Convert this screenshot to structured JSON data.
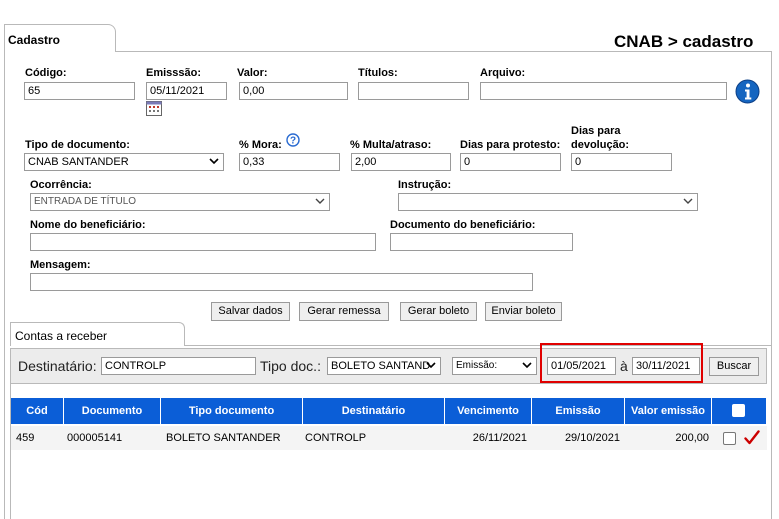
{
  "header": {
    "tab_label": "Cadastro",
    "breadcrumb": "CNAB > cadastro"
  },
  "form": {
    "codigo": {
      "label": "Código:",
      "value": "65"
    },
    "emissao": {
      "label": "Emisssão:",
      "value": "05/11/2021"
    },
    "valor": {
      "label": "Valor:",
      "value": "0,00"
    },
    "titulos": {
      "label": "Títulos:",
      "value": ""
    },
    "arquivo": {
      "label": "Arquivo:",
      "value": ""
    },
    "tipo_documento": {
      "label": "Tipo de documento:",
      "value": "CNAB SANTANDER"
    },
    "mora": {
      "label": "% Mora:",
      "value": "0,33"
    },
    "multa": {
      "label": "% Multa/atraso:",
      "value": "2,00"
    },
    "dias_protesto": {
      "label": "Dias para protesto:",
      "value": "0"
    },
    "dias_devolucao": {
      "label_line1": "Dias para",
      "label_line2": "devolução:",
      "value": "0"
    },
    "ocorrencia": {
      "label": "Ocorrência:",
      "value": "ENTRADA DE TÍTULO"
    },
    "instrucao": {
      "label": "Instrução:",
      "value": ""
    },
    "nome_beneficiario": {
      "label": "Nome do beneficiário:",
      "value": ""
    },
    "documento_beneficiario": {
      "label": "Documento do beneficiário:",
      "value": ""
    },
    "mensagem": {
      "label": "Mensagem:",
      "value": ""
    }
  },
  "actions": {
    "salvar": "Salvar dados",
    "gerar_remessa": "Gerar remessa",
    "gerar_boleto": "Gerar boleto",
    "enviar_boleto": "Enviar boleto"
  },
  "receivables": {
    "tab_label": "Contas a receber",
    "filter": {
      "destinatario_label": "Destinatário:",
      "destinatario_value": "CONTROLP",
      "tipo_doc_label": "Tipo doc.:",
      "tipo_doc_value": "BOLETO SANTAND",
      "date_type_value": "Emissão:",
      "date_from": "01/05/2021",
      "date_sep": "à",
      "date_to": "30/11/2021",
      "search_label": "Buscar"
    },
    "columns": [
      "Cód",
      "Documento",
      "Tipo documento",
      "Destinatário",
      "Vencimento",
      "Emissão",
      "Valor emissão"
    ],
    "rows": [
      {
        "cod": "459",
        "documento": "000005141",
        "tipo": "BOLETO SANTANDER",
        "destinatario": "CONTROLP",
        "vencimento": "26/11/2021",
        "emissao": "29/10/2021",
        "valor": "200,00"
      }
    ]
  },
  "colors": {
    "header_blue": "#0b5ed7",
    "highlight_red": "#e00000",
    "check_red": "#cc0000",
    "info_blue": "#1565c0"
  },
  "icons": [
    "calendar-icon",
    "help-icon",
    "info-icon",
    "chevron-down-icon",
    "checkmark-icon"
  ]
}
